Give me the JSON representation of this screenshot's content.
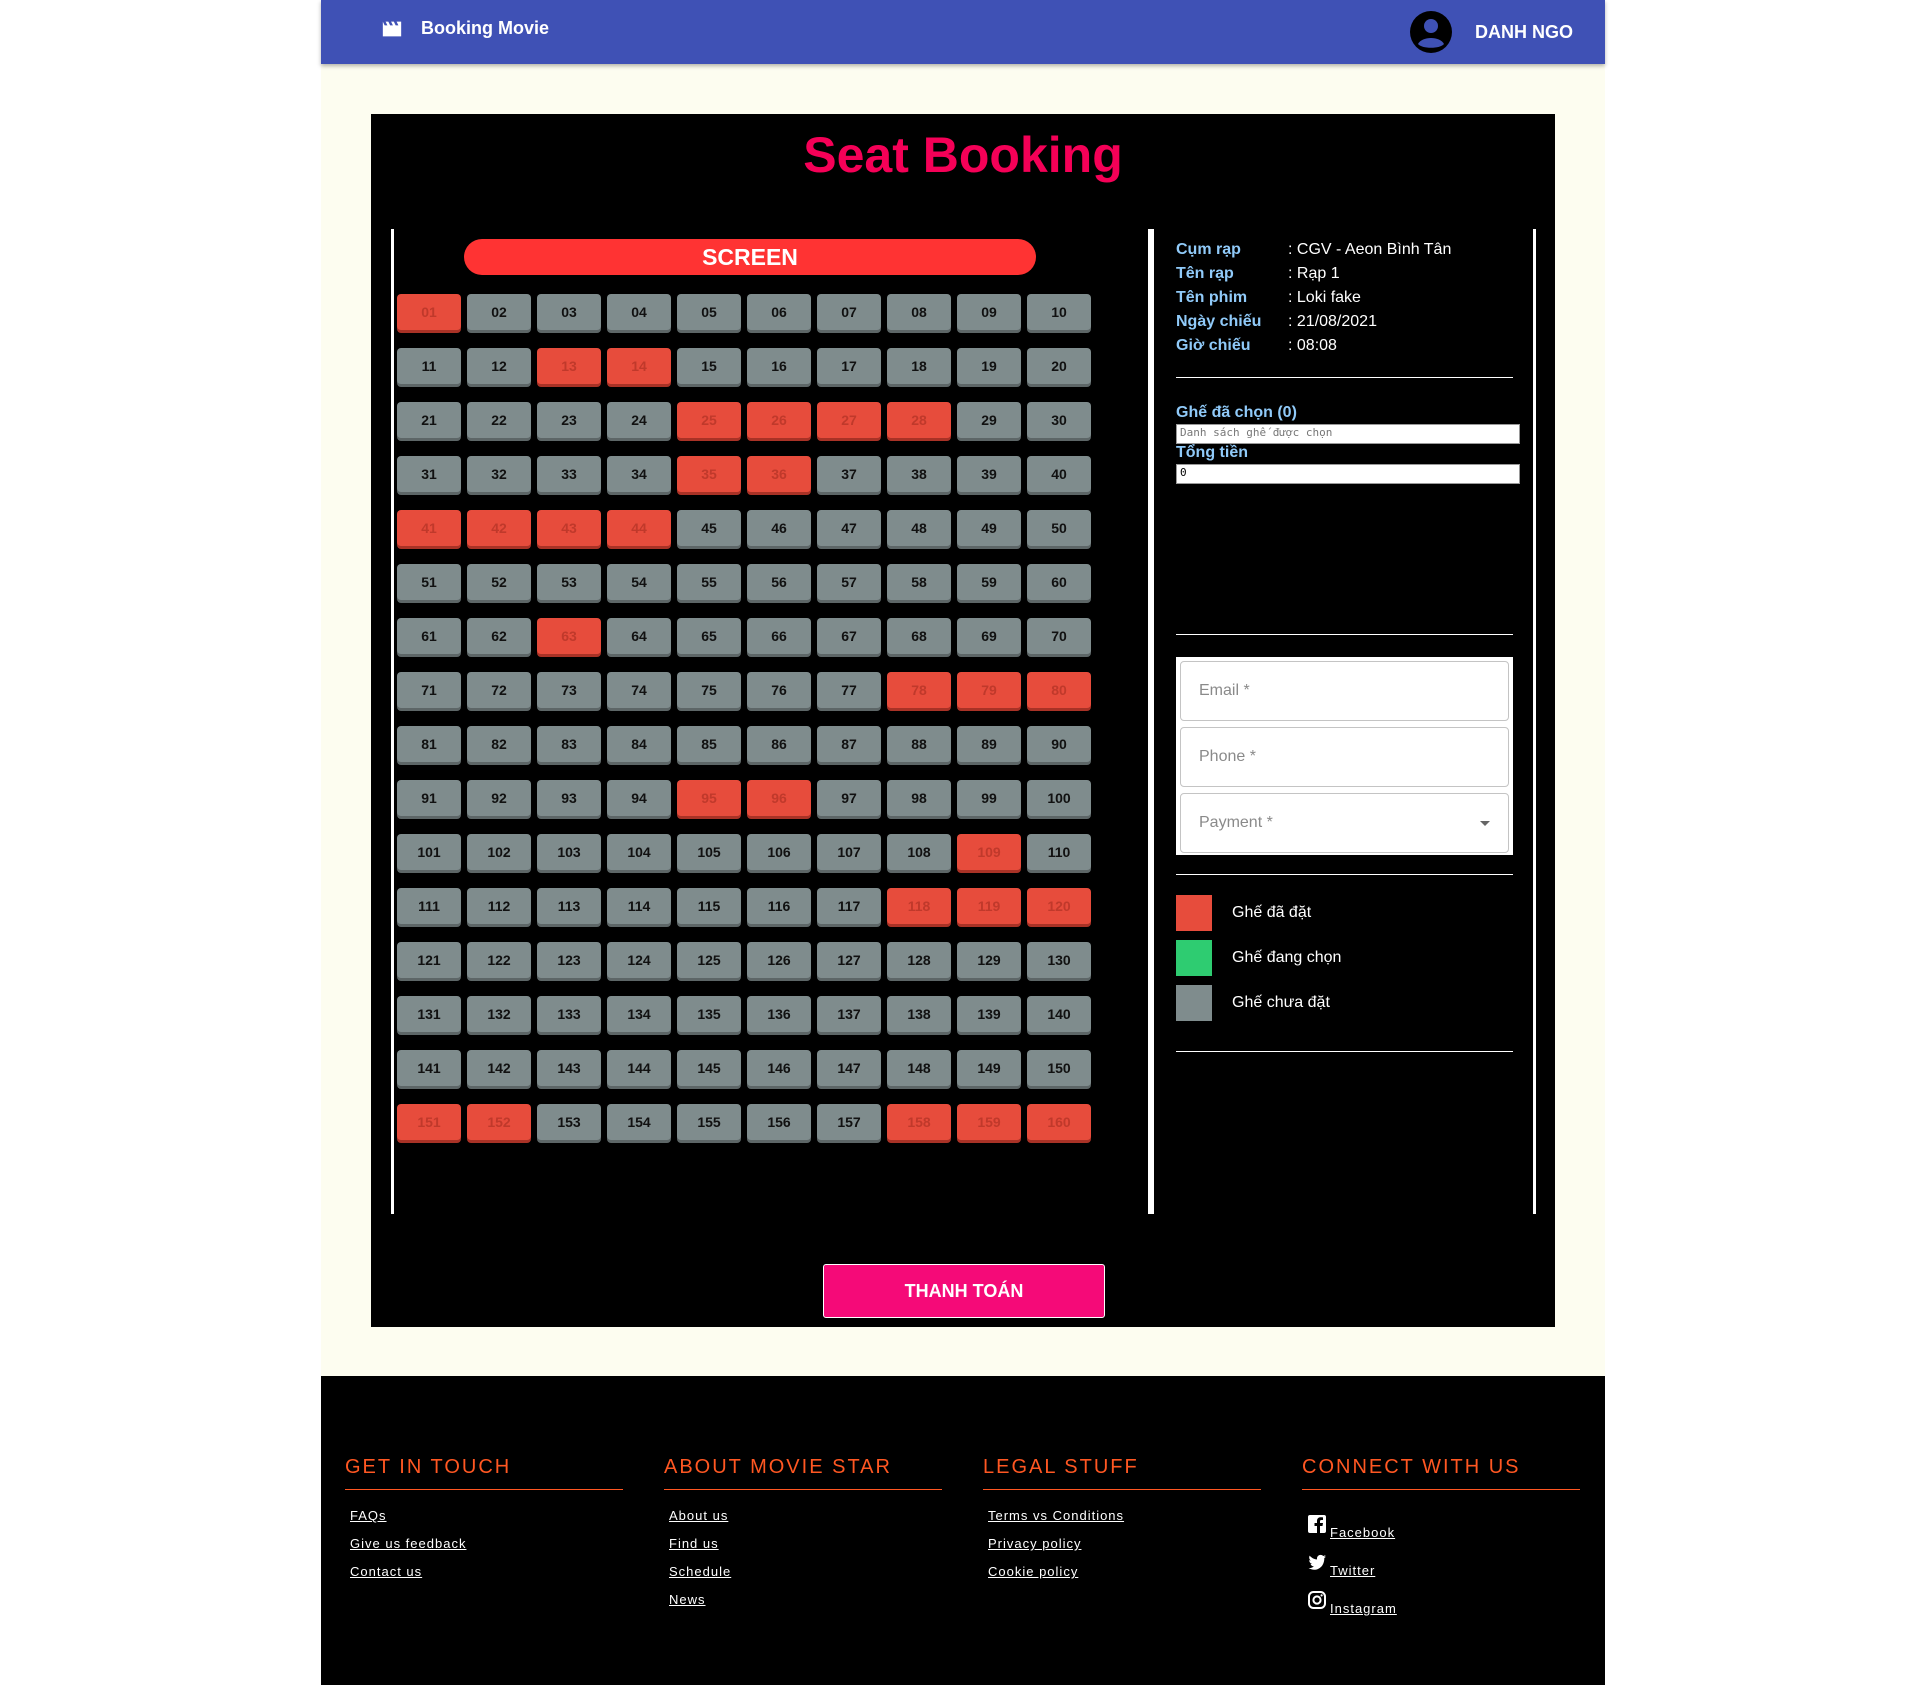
{
  "header": {
    "brand": "Booking Movie",
    "user_name": "DANH NGO"
  },
  "booking": {
    "title": "Seat Booking",
    "screen_label": "SCREEN",
    "seats": [
      {
        "label": "01",
        "status": "booked"
      },
      {
        "label": "02",
        "status": "available"
      },
      {
        "label": "03",
        "status": "available"
      },
      {
        "label": "04",
        "status": "available"
      },
      {
        "label": "05",
        "status": "available"
      },
      {
        "label": "06",
        "status": "available"
      },
      {
        "label": "07",
        "status": "available"
      },
      {
        "label": "08",
        "status": "available"
      },
      {
        "label": "09",
        "status": "available"
      },
      {
        "label": "10",
        "status": "available"
      },
      {
        "label": "11",
        "status": "available"
      },
      {
        "label": "12",
        "status": "available"
      },
      {
        "label": "13",
        "status": "booked"
      },
      {
        "label": "14",
        "status": "booked"
      },
      {
        "label": "15",
        "status": "available"
      },
      {
        "label": "16",
        "status": "available"
      },
      {
        "label": "17",
        "status": "available"
      },
      {
        "label": "18",
        "status": "available"
      },
      {
        "label": "19",
        "status": "available"
      },
      {
        "label": "20",
        "status": "available"
      },
      {
        "label": "21",
        "status": "available"
      },
      {
        "label": "22",
        "status": "available"
      },
      {
        "label": "23",
        "status": "available"
      },
      {
        "label": "24",
        "status": "available"
      },
      {
        "label": "25",
        "status": "booked"
      },
      {
        "label": "26",
        "status": "booked"
      },
      {
        "label": "27",
        "status": "booked"
      },
      {
        "label": "28",
        "status": "booked"
      },
      {
        "label": "29",
        "status": "available"
      },
      {
        "label": "30",
        "status": "available"
      },
      {
        "label": "31",
        "status": "available"
      },
      {
        "label": "32",
        "status": "available"
      },
      {
        "label": "33",
        "status": "available"
      },
      {
        "label": "34",
        "status": "available"
      },
      {
        "label": "35",
        "status": "booked"
      },
      {
        "label": "36",
        "status": "booked"
      },
      {
        "label": "37",
        "status": "available"
      },
      {
        "label": "38",
        "status": "available"
      },
      {
        "label": "39",
        "status": "available"
      },
      {
        "label": "40",
        "status": "available"
      },
      {
        "label": "41",
        "status": "booked"
      },
      {
        "label": "42",
        "status": "booked"
      },
      {
        "label": "43",
        "status": "booked"
      },
      {
        "label": "44",
        "status": "booked"
      },
      {
        "label": "45",
        "status": "available"
      },
      {
        "label": "46",
        "status": "available"
      },
      {
        "label": "47",
        "status": "available"
      },
      {
        "label": "48",
        "status": "available"
      },
      {
        "label": "49",
        "status": "available"
      },
      {
        "label": "50",
        "status": "available"
      },
      {
        "label": "51",
        "status": "available"
      },
      {
        "label": "52",
        "status": "available"
      },
      {
        "label": "53",
        "status": "available"
      },
      {
        "label": "54",
        "status": "available"
      },
      {
        "label": "55",
        "status": "available"
      },
      {
        "label": "56",
        "status": "available"
      },
      {
        "label": "57",
        "status": "available"
      },
      {
        "label": "58",
        "status": "available"
      },
      {
        "label": "59",
        "status": "available"
      },
      {
        "label": "60",
        "status": "available"
      },
      {
        "label": "61",
        "status": "available"
      },
      {
        "label": "62",
        "status": "available"
      },
      {
        "label": "63",
        "status": "booked"
      },
      {
        "label": "64",
        "status": "available"
      },
      {
        "label": "65",
        "status": "available"
      },
      {
        "label": "66",
        "status": "available"
      },
      {
        "label": "67",
        "status": "available"
      },
      {
        "label": "68",
        "status": "available"
      },
      {
        "label": "69",
        "status": "available"
      },
      {
        "label": "70",
        "status": "available"
      },
      {
        "label": "71",
        "status": "available"
      },
      {
        "label": "72",
        "status": "available"
      },
      {
        "label": "73",
        "status": "available"
      },
      {
        "label": "74",
        "status": "available"
      },
      {
        "label": "75",
        "status": "available"
      },
      {
        "label": "76",
        "status": "available"
      },
      {
        "label": "77",
        "status": "available"
      },
      {
        "label": "78",
        "status": "booked"
      },
      {
        "label": "79",
        "status": "booked"
      },
      {
        "label": "80",
        "status": "booked"
      },
      {
        "label": "81",
        "status": "available"
      },
      {
        "label": "82",
        "status": "available"
      },
      {
        "label": "83",
        "status": "available"
      },
      {
        "label": "84",
        "status": "available"
      },
      {
        "label": "85",
        "status": "available"
      },
      {
        "label": "86",
        "status": "available"
      },
      {
        "label": "87",
        "status": "available"
      },
      {
        "label": "88",
        "status": "available"
      },
      {
        "label": "89",
        "status": "available"
      },
      {
        "label": "90",
        "status": "available"
      },
      {
        "label": "91",
        "status": "available"
      },
      {
        "label": "92",
        "status": "available"
      },
      {
        "label": "93",
        "status": "available"
      },
      {
        "label": "94",
        "status": "available"
      },
      {
        "label": "95",
        "status": "booked"
      },
      {
        "label": "96",
        "status": "booked"
      },
      {
        "label": "97",
        "status": "available"
      },
      {
        "label": "98",
        "status": "available"
      },
      {
        "label": "99",
        "status": "available"
      },
      {
        "label": "100",
        "status": "available"
      },
      {
        "label": "101",
        "status": "available"
      },
      {
        "label": "102",
        "status": "available"
      },
      {
        "label": "103",
        "status": "available"
      },
      {
        "label": "104",
        "status": "available"
      },
      {
        "label": "105",
        "status": "available"
      },
      {
        "label": "106",
        "status": "available"
      },
      {
        "label": "107",
        "status": "available"
      },
      {
        "label": "108",
        "status": "available"
      },
      {
        "label": "109",
        "status": "booked"
      },
      {
        "label": "110",
        "status": "available"
      },
      {
        "label": "111",
        "status": "available"
      },
      {
        "label": "112",
        "status": "available"
      },
      {
        "label": "113",
        "status": "available"
      },
      {
        "label": "114",
        "status": "available"
      },
      {
        "label": "115",
        "status": "available"
      },
      {
        "label": "116",
        "status": "available"
      },
      {
        "label": "117",
        "status": "available"
      },
      {
        "label": "118",
        "status": "booked"
      },
      {
        "label": "119",
        "status": "booked"
      },
      {
        "label": "120",
        "status": "booked"
      },
      {
        "label": "121",
        "status": "available"
      },
      {
        "label": "122",
        "status": "available"
      },
      {
        "label": "123",
        "status": "available"
      },
      {
        "label": "124",
        "status": "available"
      },
      {
        "label": "125",
        "status": "available"
      },
      {
        "label": "126",
        "status": "available"
      },
      {
        "label": "127",
        "status": "available"
      },
      {
        "label": "128",
        "status": "available"
      },
      {
        "label": "129",
        "status": "available"
      },
      {
        "label": "130",
        "status": "available"
      },
      {
        "label": "131",
        "status": "available"
      },
      {
        "label": "132",
        "status": "available"
      },
      {
        "label": "133",
        "status": "available"
      },
      {
        "label": "134",
        "status": "available"
      },
      {
        "label": "135",
        "status": "available"
      },
      {
        "label": "136",
        "status": "available"
      },
      {
        "label": "137",
        "status": "available"
      },
      {
        "label": "138",
        "status": "available"
      },
      {
        "label": "139",
        "status": "available"
      },
      {
        "label": "140",
        "status": "available"
      },
      {
        "label": "141",
        "status": "available"
      },
      {
        "label": "142",
        "status": "available"
      },
      {
        "label": "143",
        "status": "available"
      },
      {
        "label": "144",
        "status": "available"
      },
      {
        "label": "145",
        "status": "available"
      },
      {
        "label": "146",
        "status": "available"
      },
      {
        "label": "147",
        "status": "available"
      },
      {
        "label": "148",
        "status": "available"
      },
      {
        "label": "149",
        "status": "available"
      },
      {
        "label": "150",
        "status": "available"
      },
      {
        "label": "151",
        "status": "booked"
      },
      {
        "label": "152",
        "status": "booked"
      },
      {
        "label": "153",
        "status": "available"
      },
      {
        "label": "154",
        "status": "available"
      },
      {
        "label": "155",
        "status": "available"
      },
      {
        "label": "156",
        "status": "available"
      },
      {
        "label": "157",
        "status": "available"
      },
      {
        "label": "158",
        "status": "booked"
      },
      {
        "label": "159",
        "status": "booked"
      },
      {
        "label": "160",
        "status": "booked"
      }
    ],
    "info": [
      {
        "label": "Cụm rạp",
        "value": ": CGV - Aeon Bình Tân"
      },
      {
        "label": "Tên rạp",
        "value": ": Rạp 1"
      },
      {
        "label": "Tên phim",
        "value": ": Loki fake"
      },
      {
        "label": "Ngày chiếu",
        "value": ": 21/08/2021"
      },
      {
        "label": "Giờ chiếu",
        "value": ": 08:08"
      }
    ],
    "selected_label": "Ghế đã chọn (0)",
    "selected_placeholder": "Danh sách ghế được chọn",
    "total_label": "Tổng tiền",
    "total_value": "0",
    "form": {
      "email_label": "Email *",
      "phone_label": "Phone *",
      "payment_label": "Payment *"
    },
    "legend": [
      {
        "label": "Ghế đã đặt",
        "color": "#e74c3c"
      },
      {
        "label": "Ghế đang chọn",
        "color": "#2ecc71"
      },
      {
        "label": "Ghế chưa đặt",
        "color": "#7f8c8d"
      }
    ],
    "pay_button": "THANH TOÁN"
  },
  "footer": {
    "columns": [
      {
        "heading": "GET IN TOUCH",
        "links": [
          "FAQs",
          "Give us feedback",
          "Contact us"
        ]
      },
      {
        "heading": "ABOUT MOVIE STAR",
        "links": [
          "About us",
          "Find us",
          "Schedule",
          "News"
        ]
      },
      {
        "heading": "LEGAL STUFF",
        "links": [
          "Terms vs Conditions",
          "Privacy policy",
          "Cookie policy"
        ]
      },
      {
        "heading": "CONNECT WITH US",
        "links": [
          "Facebook",
          "Twitter",
          "Instagram"
        ]
      }
    ]
  },
  "colors": {
    "appbar": "#3f51b5",
    "title": "#f50057",
    "booked": "#e74c3c",
    "selecting": "#2ecc71",
    "available": "#7f8c8d",
    "footer_accent": "#ff5722"
  }
}
